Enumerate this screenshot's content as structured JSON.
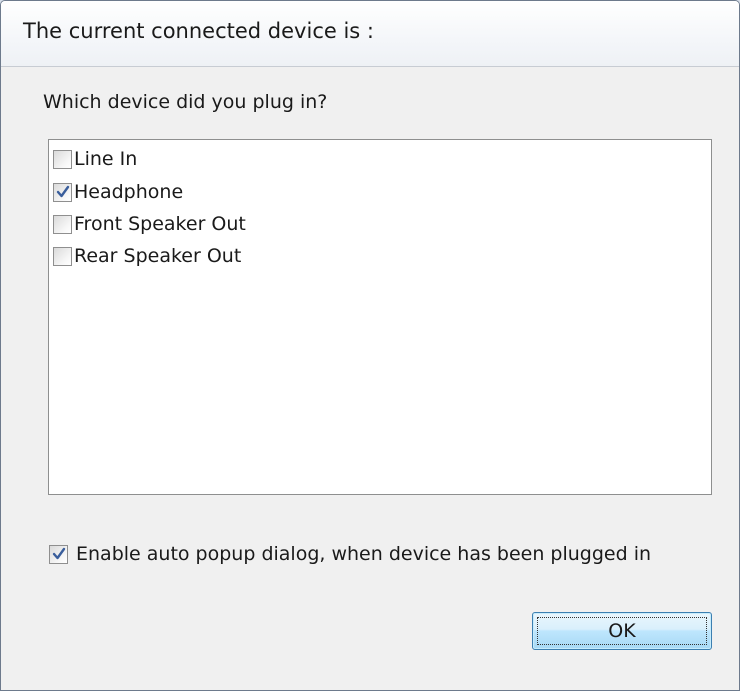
{
  "dialog": {
    "title": "The current connected device is :",
    "prompt": "Which device did you plug in?"
  },
  "devices": [
    {
      "label": "Line In",
      "checked": false
    },
    {
      "label": "Headphone",
      "checked": true
    },
    {
      "label": "Front Speaker Out",
      "checked": false
    },
    {
      "label": "Rear Speaker Out",
      "checked": false
    }
  ],
  "auto_popup": {
    "label": "Enable auto popup dialog, when device has been plugged in",
    "checked": true
  },
  "buttons": {
    "ok_label": "OK"
  },
  "colors": {
    "checkmark": "#3a5e9c",
    "ok_border": "#3c7fb1"
  },
  "icons": {
    "check": "checkmark-icon"
  }
}
